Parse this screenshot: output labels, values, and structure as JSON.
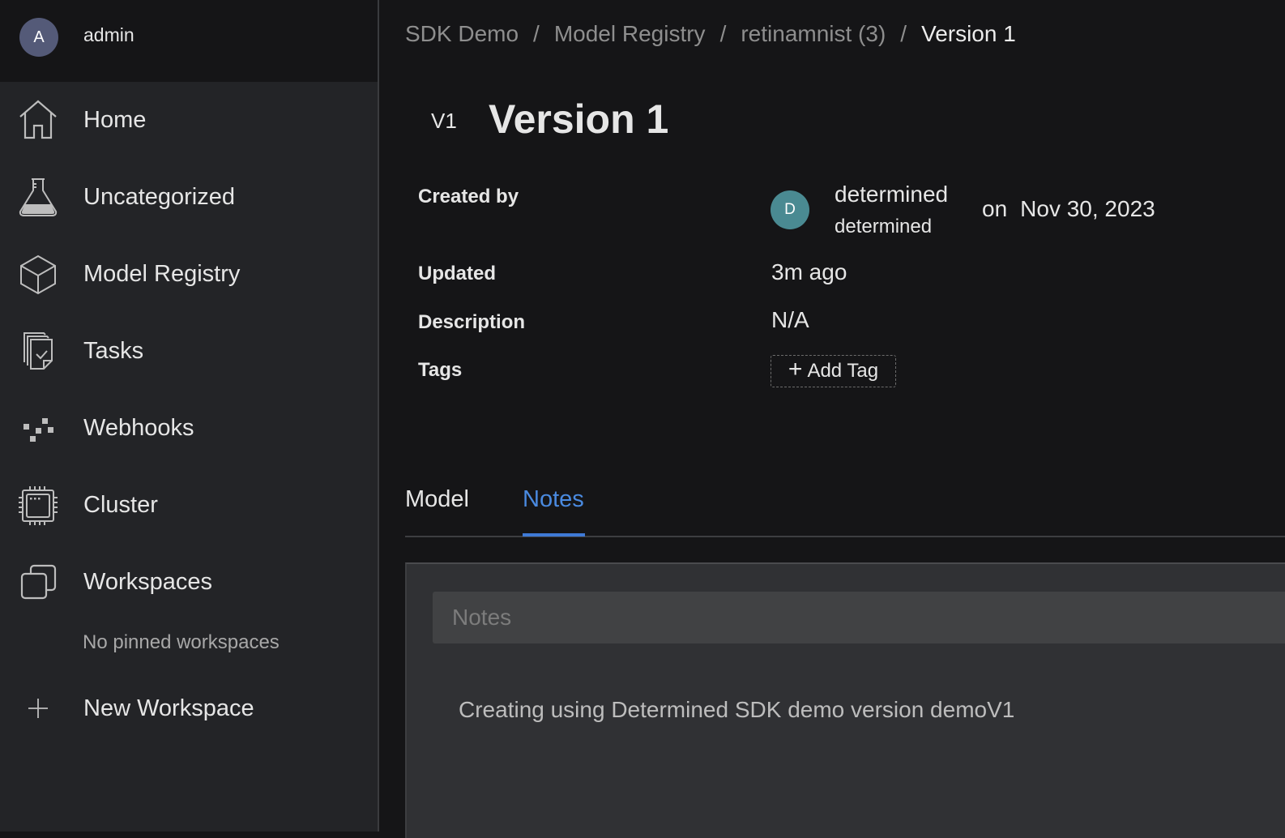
{
  "user": {
    "avatar_initial": "A",
    "name": "admin",
    "avatar_color": "#545a78"
  },
  "sidebar": {
    "items": [
      {
        "label": "Home",
        "icon": "home-icon"
      },
      {
        "label": "Uncategorized",
        "icon": "flask-icon"
      },
      {
        "label": "Model Registry",
        "icon": "cube-icon"
      },
      {
        "label": "Tasks",
        "icon": "tasks-icon"
      },
      {
        "label": "Webhooks",
        "icon": "webhooks-icon"
      },
      {
        "label": "Cluster",
        "icon": "chip-icon"
      },
      {
        "label": "Workspaces",
        "icon": "workspaces-icon"
      }
    ],
    "no_pinned_text": "No pinned workspaces",
    "new_workspace_label": "New Workspace"
  },
  "breadcrumb": {
    "items": [
      "SDK Demo",
      "Model Registry",
      "retinamnist (3)",
      "Version 1"
    ],
    "separator": "/"
  },
  "header": {
    "version_badge": "V1",
    "title": "Version 1"
  },
  "meta": {
    "created_by_label": "Created by",
    "creator_initial": "D",
    "creator_avatar_color": "#4a8a92",
    "creator_display_name": "determined",
    "creator_username": "determined",
    "on_word": "on",
    "created_date": "Nov 30, 2023",
    "updated_label": "Updated",
    "updated_value": "3m ago",
    "description_label": "Description",
    "description_value": "N/A",
    "tags_label": "Tags",
    "add_tag_label": "Add Tag"
  },
  "tabs": {
    "items": [
      "Model",
      "Notes"
    ],
    "active": "Notes",
    "accent_color": "#3f7ad6"
  },
  "notes": {
    "title_placeholder": "Notes",
    "title_value": "",
    "body": "Creating using Determined SDK demo version demoV1"
  }
}
